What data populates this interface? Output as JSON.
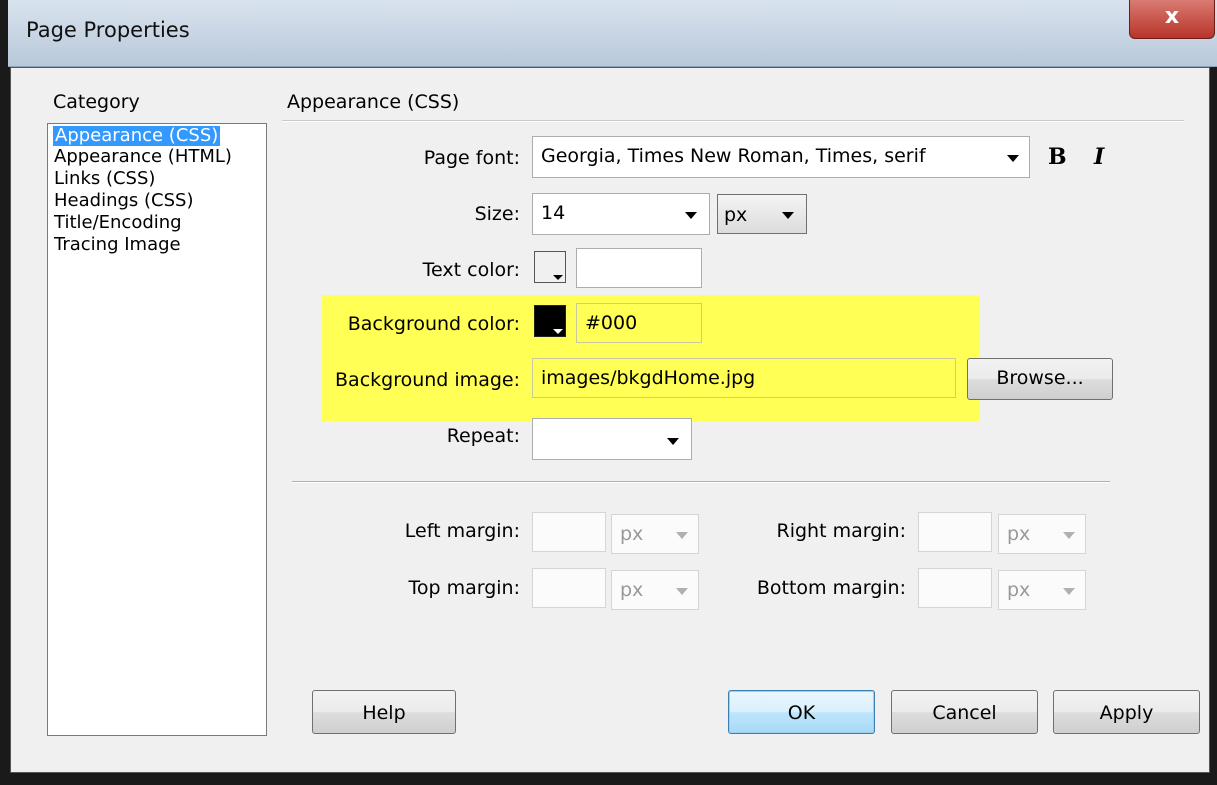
{
  "window": {
    "title": "Page Properties",
    "close_label": "x"
  },
  "category": {
    "heading": "Category",
    "items": [
      "Appearance (CSS)",
      "Appearance (HTML)",
      "Links (CSS)",
      "Headings (CSS)",
      "Title/Encoding",
      "Tracing Image"
    ],
    "selected": "Appearance (CSS)"
  },
  "section": {
    "heading": "Appearance (CSS)"
  },
  "form": {
    "page_font_label": "Page font:",
    "page_font_value": "Georgia, Times New Roman, Times, serif",
    "bold_label": "B",
    "italic_label": "I",
    "size_label": "Size:",
    "size_value": "14",
    "size_unit": "px",
    "text_color_label": "Text color:",
    "text_color_value": "",
    "bg_color_label": "Background color:",
    "bg_color_value": "#000",
    "bg_image_label": "Background image:",
    "bg_image_value": "images/bkgdHome.jpg",
    "browse_label": "Browse...",
    "repeat_label": "Repeat:",
    "repeat_value": ""
  },
  "margins": {
    "left_label": "Left margin:",
    "right_label": "Right margin:",
    "top_label": "Top margin:",
    "bottom_label": "Bottom margin:",
    "unit": "px"
  },
  "buttons": {
    "help": "Help",
    "ok": "OK",
    "cancel": "Cancel",
    "apply": "Apply"
  },
  "colors": {
    "highlight": "#ffff55",
    "selection": "#3399ff",
    "bg_swatch": "#000000"
  }
}
